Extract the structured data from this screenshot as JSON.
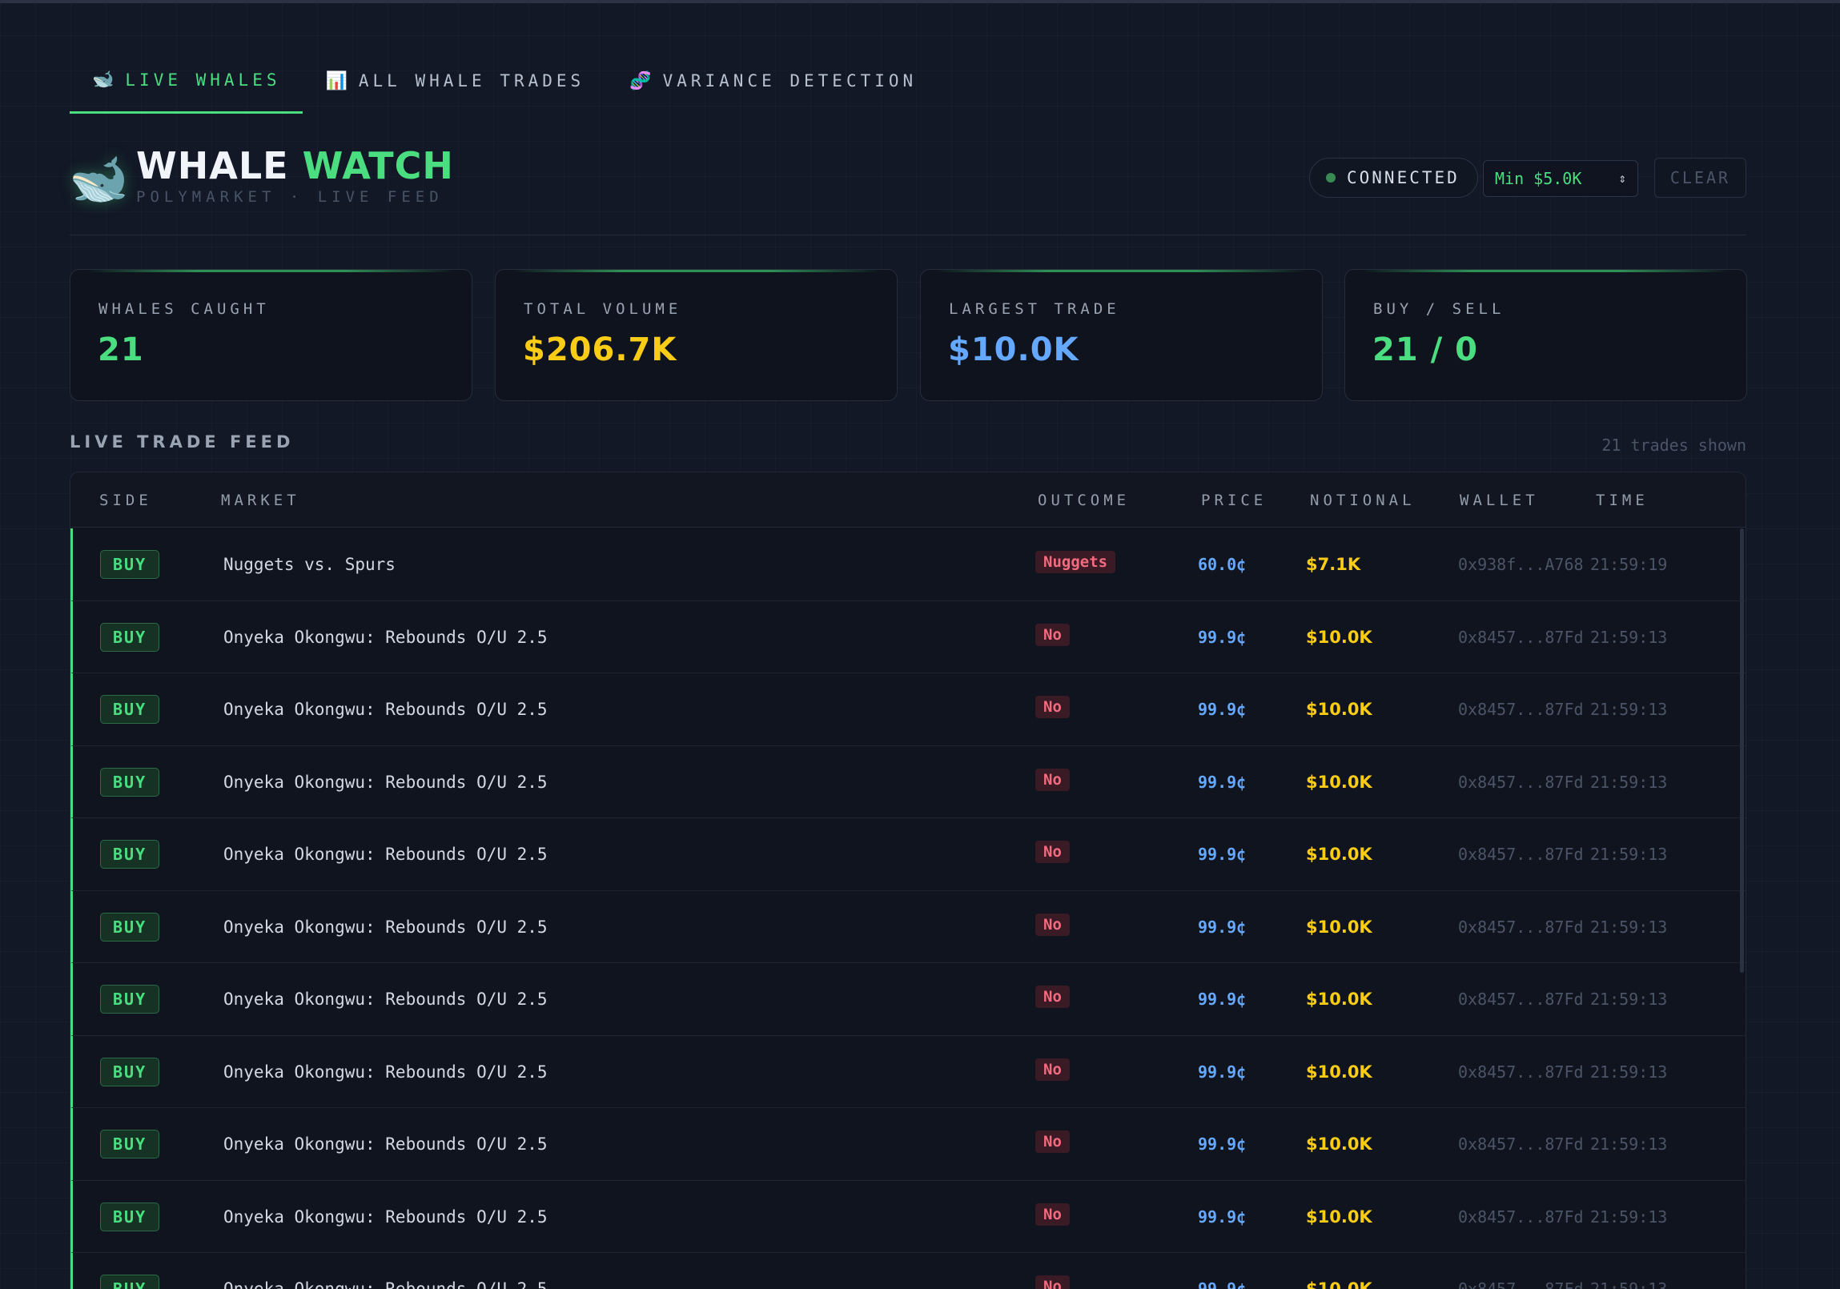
{
  "tabs": [
    {
      "icon": "🐋",
      "label": "LIVE WHALES",
      "active": true
    },
    {
      "icon": "📊",
      "label": "ALL WHALE TRADES",
      "active": false
    },
    {
      "icon": "🧬",
      "label": "VARIANCE DETECTION",
      "active": false
    }
  ],
  "header": {
    "icon": "🐋",
    "title_main": "WHALE",
    "title_accent": "WATCH",
    "subtitle": "POLYMARKET · LIVE FEED",
    "status": "CONNECTED",
    "min_filter": "Min $5.0K",
    "clear_label": "CLEAR"
  },
  "stats": [
    {
      "label": "WHALES CAUGHT",
      "value": "21",
      "color": "#4ade80"
    },
    {
      "label": "TOTAL VOLUME",
      "value": "$206.7K",
      "color": "#facc15"
    },
    {
      "label": "LARGEST TRADE",
      "value": "$10.0K",
      "color": "#64a8ff"
    },
    {
      "label": "BUY / SELL",
      "value": "21 / 0",
      "color": "#4ade80"
    }
  ],
  "feed": {
    "title": "LIVE TRADE FEED",
    "count_text": "21 trades shown",
    "columns": {
      "side": "SIDE",
      "market": "MARKET",
      "outcome": "OUTCOME",
      "price": "PRICE",
      "notional": "NOTIONAL",
      "wallet": "WALLET",
      "time": "TIME"
    },
    "rows": [
      {
        "side": "BUY",
        "market": "Nuggets vs. Spurs",
        "outcome": "Nuggets",
        "price": "60.0¢",
        "notional": "$7.1K",
        "wallet": "0x938f...A768",
        "time": "21:59:19"
      },
      {
        "side": "BUY",
        "market": "Onyeka Okongwu: Rebounds O/U 2.5",
        "outcome": "No",
        "price": "99.9¢",
        "notional": "$10.0K",
        "wallet": "0x8457...87Fd",
        "time": "21:59:13"
      },
      {
        "side": "BUY",
        "market": "Onyeka Okongwu: Rebounds O/U 2.5",
        "outcome": "No",
        "price": "99.9¢",
        "notional": "$10.0K",
        "wallet": "0x8457...87Fd",
        "time": "21:59:13"
      },
      {
        "side": "BUY",
        "market": "Onyeka Okongwu: Rebounds O/U 2.5",
        "outcome": "No",
        "price": "99.9¢",
        "notional": "$10.0K",
        "wallet": "0x8457...87Fd",
        "time": "21:59:13"
      },
      {
        "side": "BUY",
        "market": "Onyeka Okongwu: Rebounds O/U 2.5",
        "outcome": "No",
        "price": "99.9¢",
        "notional": "$10.0K",
        "wallet": "0x8457...87Fd",
        "time": "21:59:13"
      },
      {
        "side": "BUY",
        "market": "Onyeka Okongwu: Rebounds O/U 2.5",
        "outcome": "No",
        "price": "99.9¢",
        "notional": "$10.0K",
        "wallet": "0x8457...87Fd",
        "time": "21:59:13"
      },
      {
        "side": "BUY",
        "market": "Onyeka Okongwu: Rebounds O/U 2.5",
        "outcome": "No",
        "price": "99.9¢",
        "notional": "$10.0K",
        "wallet": "0x8457...87Fd",
        "time": "21:59:13"
      },
      {
        "side": "BUY",
        "market": "Onyeka Okongwu: Rebounds O/U 2.5",
        "outcome": "No",
        "price": "99.9¢",
        "notional": "$10.0K",
        "wallet": "0x8457...87Fd",
        "time": "21:59:13"
      },
      {
        "side": "BUY",
        "market": "Onyeka Okongwu: Rebounds O/U 2.5",
        "outcome": "No",
        "price": "99.9¢",
        "notional": "$10.0K",
        "wallet": "0x8457...87Fd",
        "time": "21:59:13"
      },
      {
        "side": "BUY",
        "market": "Onyeka Okongwu: Rebounds O/U 2.5",
        "outcome": "No",
        "price": "99.9¢",
        "notional": "$10.0K",
        "wallet": "0x8457...87Fd",
        "time": "21:59:13"
      },
      {
        "side": "BUY",
        "market": "Onyeka Okongwu: Rebounds O/U 2.5",
        "outcome": "No",
        "price": "99.9¢",
        "notional": "$10.0K",
        "wallet": "0x8457...87Fd",
        "time": "21:59:13"
      }
    ]
  }
}
